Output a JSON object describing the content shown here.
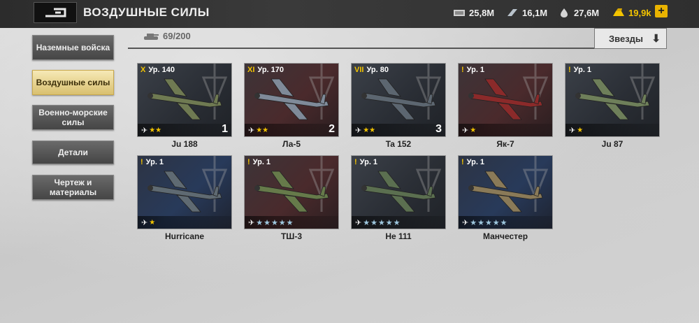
{
  "header": {
    "title": "ВОЗДУШНЫЕ СИЛЫ",
    "resources": [
      {
        "icon": "money-icon",
        "value": "25,8M"
      },
      {
        "icon": "steel-icon",
        "value": "16,1M"
      },
      {
        "icon": "fuel-icon",
        "value": "27,6M"
      },
      {
        "icon": "gold-bars-icon",
        "value": "19,9k"
      }
    ],
    "add_label": "+"
  },
  "sidebar": {
    "items": [
      {
        "label": "Наземные войска",
        "active": false
      },
      {
        "label": "Воздушные силы",
        "active": true
      },
      {
        "label": "Военно-морские силы",
        "active": false
      },
      {
        "label": "Детали",
        "active": false
      },
      {
        "label": "Чертеж и материалы",
        "active": false
      }
    ]
  },
  "filter": {
    "count": "69/200",
    "sort_label": "Звезды",
    "sort_icon": "arrow-down-icon"
  },
  "units": [
    {
      "rank": "X",
      "level": "Ур. 140",
      "name": "Ju 188",
      "slot": "1",
      "stars": "★★",
      "bg": "dark"
    },
    {
      "rank": "XI",
      "level": "Ур. 170",
      "name": "Ла-5",
      "slot": "2",
      "stars": "★★",
      "bg": "red"
    },
    {
      "rank": "VII",
      "level": "Ур. 80",
      "name": "Ta 152",
      "slot": "3",
      "stars": "★★",
      "bg": "dark"
    },
    {
      "rank": "!",
      "level": "Ур. 1",
      "name": "Як-7",
      "slot": "",
      "stars": "★",
      "bg": "red"
    },
    {
      "rank": "!",
      "level": "Ур. 1",
      "name": "Ju 87",
      "slot": "",
      "stars": "★",
      "bg": "dark"
    },
    {
      "rank": "!",
      "level": "Ур. 1",
      "name": "Hurricane",
      "slot": "",
      "stars": "★",
      "bg": "blue"
    },
    {
      "rank": "!",
      "level": "Ур. 1",
      "name": "ТШ-3",
      "slot": "",
      "stars": "★★★★★",
      "bg": "red"
    },
    {
      "rank": "!",
      "level": "Ур. 1",
      "name": "He 111",
      "slot": "",
      "stars": "★★★★★",
      "bg": "dark"
    },
    {
      "rank": "!",
      "level": "Ур. 1",
      "name": "Манчестер",
      "slot": "",
      "stars": "★★★★★",
      "bg": "blue"
    }
  ],
  "colors": {
    "accent_gold": "#f3c400",
    "active_tab": "#e8d590",
    "star_blue": "#9ec7de"
  }
}
